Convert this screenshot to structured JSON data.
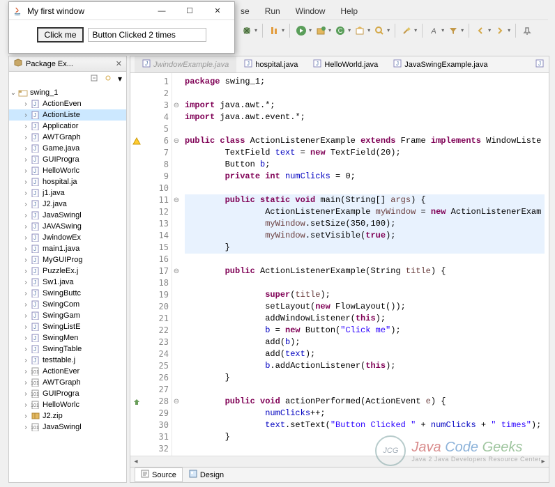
{
  "popup": {
    "title": "My first window",
    "button_label": "Click me",
    "output_text": "Button Clicked 2 times"
  },
  "menubar": {
    "items": [
      "se",
      "Run",
      "Window",
      "Help"
    ]
  },
  "package_explorer": {
    "title": "Package Ex...",
    "root": "swing_1",
    "files": [
      "ActionEven",
      "ActionListe",
      "Applicatior",
      "AWTGraph",
      "Game.java",
      "GUIProgra",
      "HelloWorlc",
      "hospital.ja",
      "j1.java",
      "J2.java",
      "JavaSwingl",
      "JAVASwing",
      "JwindowEx",
      "main1.java",
      "MyGUIProg",
      "PuzzleEx.j",
      "Sw1.java",
      "SwingButtc",
      "SwingCom",
      "SwingGam",
      "SwingListE",
      "SwingMen",
      "SwingTable",
      "testtable.j",
      "ActionEver",
      "AWTGraph",
      "GUIProgra",
      "HelloWorlc",
      "J2.zip",
      "JavaSwingl"
    ],
    "selected_index": 1
  },
  "editor_tabs": {
    "hidden": "JwindowExample.java",
    "tabs": [
      "hospital.java",
      "HelloWorld.java",
      "JavaSwingExample.java"
    ]
  },
  "code": {
    "lines": [
      {
        "n": 1,
        "t": "package swing_1;",
        "tokens": [
          [
            "kw",
            "package"
          ],
          [
            "",
            " swing_1;"
          ]
        ]
      },
      {
        "n": 2,
        "t": ""
      },
      {
        "n": 3,
        "t": "import java.awt.*;",
        "fold": "⊖",
        "tokens": [
          [
            "kw",
            "import"
          ],
          [
            "",
            " java.awt.*;"
          ]
        ]
      },
      {
        "n": 4,
        "t": "import java.awt.event.*;",
        "tokens": [
          [
            "kw",
            "import"
          ],
          [
            "",
            " java.awt.event.*;"
          ]
        ]
      },
      {
        "n": 5,
        "t": ""
      },
      {
        "n": 6,
        "t": "public class ActionListenerExample extends Frame implements WindowListe",
        "marker": "warn",
        "fold": "⊖",
        "tokens": [
          [
            "kw",
            "public class"
          ],
          [
            "",
            " "
          ],
          [
            "type",
            "ActionListenerExample"
          ],
          [
            "",
            " "
          ],
          [
            "kw",
            "extends"
          ],
          [
            "",
            " Frame "
          ],
          [
            "kw",
            "implements"
          ],
          [
            "",
            " WindowListe"
          ]
        ]
      },
      {
        "n": 7,
        "t": "        TextField text = new TextField(20);",
        "tokens": [
          [
            "",
            "        TextField "
          ],
          [
            "field",
            "text"
          ],
          [
            "",
            " = "
          ],
          [
            "kw",
            "new"
          ],
          [
            "",
            " TextField(20);"
          ]
        ]
      },
      {
        "n": 8,
        "t": "        Button b;",
        "tokens": [
          [
            "",
            "        Button "
          ],
          [
            "field",
            "b"
          ],
          [
            "",
            ";"
          ]
        ]
      },
      {
        "n": 9,
        "t": "        private int numClicks = 0;",
        "tokens": [
          [
            "",
            "        "
          ],
          [
            "kw",
            "private int"
          ],
          [
            "",
            " "
          ],
          [
            "field",
            "numClicks"
          ],
          [
            "",
            " = 0;"
          ]
        ]
      },
      {
        "n": 10,
        "t": ""
      },
      {
        "n": 11,
        "t": "        public static void main(String[] args) {",
        "fold": "⊖",
        "hl": true,
        "tokens": [
          [
            "",
            "        "
          ],
          [
            "kw",
            "public static void"
          ],
          [
            "",
            " main(String[] "
          ],
          [
            "var",
            "args"
          ],
          [
            "",
            ") {"
          ]
        ]
      },
      {
        "n": 12,
        "t": "                ActionListenerExample myWindow = new ActionListenerExam",
        "hl": true,
        "tokens": [
          [
            "",
            "                ActionListenerExample "
          ],
          [
            "var",
            "myWindow"
          ],
          [
            "",
            " = "
          ],
          [
            "kw",
            "new"
          ],
          [
            "",
            " ActionListenerExam"
          ]
        ]
      },
      {
        "n": 13,
        "t": "                myWindow.setSize(350,100);",
        "hl": true,
        "tokens": [
          [
            "",
            "                "
          ],
          [
            "var",
            "myWindow"
          ],
          [
            "",
            ".setSize(350,100);"
          ]
        ]
      },
      {
        "n": 14,
        "t": "                myWindow.setVisible(true);",
        "hl": true,
        "tokens": [
          [
            "",
            "                "
          ],
          [
            "var",
            "myWindow"
          ],
          [
            "",
            ".setVisible("
          ],
          [
            "kw",
            "true"
          ],
          [
            "",
            ");"
          ]
        ]
      },
      {
        "n": 15,
        "t": "        }",
        "hl": true
      },
      {
        "n": 16,
        "t": ""
      },
      {
        "n": 17,
        "t": "        public ActionListenerExample(String title) {",
        "fold": "⊖",
        "tokens": [
          [
            "",
            "        "
          ],
          [
            "kw",
            "public"
          ],
          [
            "",
            " ActionListenerExample(String "
          ],
          [
            "var",
            "title"
          ],
          [
            "",
            ") {"
          ]
        ]
      },
      {
        "n": 18,
        "t": ""
      },
      {
        "n": 19,
        "t": "                super(title);",
        "tokens": [
          [
            "",
            "                "
          ],
          [
            "kw",
            "super"
          ],
          [
            "",
            "("
          ],
          [
            "var",
            "title"
          ],
          [
            "",
            ");"
          ]
        ]
      },
      {
        "n": 20,
        "t": "                setLayout(new FlowLayout());",
        "tokens": [
          [
            "",
            "                setLayout("
          ],
          [
            "kw",
            "new"
          ],
          [
            "",
            " FlowLayout());"
          ]
        ]
      },
      {
        "n": 21,
        "t": "                addWindowListener(this);",
        "tokens": [
          [
            "",
            "                addWindowListener("
          ],
          [
            "kw",
            "this"
          ],
          [
            "",
            ");"
          ]
        ]
      },
      {
        "n": 22,
        "t": "                b = new Button(\"Click me\");",
        "tokens": [
          [
            "",
            "                "
          ],
          [
            "field",
            "b"
          ],
          [
            "",
            " = "
          ],
          [
            "kw",
            "new"
          ],
          [
            "",
            " Button("
          ],
          [
            "str",
            "\"Click me\""
          ],
          [
            "",
            ");"
          ]
        ]
      },
      {
        "n": 23,
        "t": "                add(b);",
        "tokens": [
          [
            "",
            "                add("
          ],
          [
            "field",
            "b"
          ],
          [
            "",
            ");"
          ]
        ]
      },
      {
        "n": 24,
        "t": "                add(text);",
        "tokens": [
          [
            "",
            "                add("
          ],
          [
            "field",
            "text"
          ],
          [
            "",
            ");"
          ]
        ]
      },
      {
        "n": 25,
        "t": "                b.addActionListener(this);",
        "tokens": [
          [
            "",
            "                "
          ],
          [
            "field",
            "b"
          ],
          [
            "",
            ".addActionListener("
          ],
          [
            "kw",
            "this"
          ],
          [
            "",
            ");"
          ]
        ]
      },
      {
        "n": 26,
        "t": "        }"
      },
      {
        "n": 27,
        "t": ""
      },
      {
        "n": 28,
        "t": "        public void actionPerformed(ActionEvent e) {",
        "fold": "⊖",
        "marker": "override",
        "tokens": [
          [
            "",
            "        "
          ],
          [
            "kw",
            "public void"
          ],
          [
            "",
            " actionPerformed(ActionEvent "
          ],
          [
            "var",
            "e"
          ],
          [
            "",
            ") {"
          ]
        ]
      },
      {
        "n": 29,
        "t": "                numClicks++;",
        "tokens": [
          [
            "",
            "                "
          ],
          [
            "field",
            "numClicks"
          ],
          [
            "",
            "++;"
          ]
        ]
      },
      {
        "n": 30,
        "t": "                text.setText(\"Button Clicked \" + numClicks + \" times\");",
        "tokens": [
          [
            "",
            "                "
          ],
          [
            "field",
            "text"
          ],
          [
            "",
            ".setText("
          ],
          [
            "str",
            "\"Button Clicked \""
          ],
          [
            "",
            " + "
          ],
          [
            "field",
            "numClicks"
          ],
          [
            "",
            " + "
          ],
          [
            "str",
            "\" times\""
          ],
          [
            "",
            ");"
          ]
        ]
      },
      {
        "n": 31,
        "t": "        }"
      },
      {
        "n": 32,
        "t": ""
      }
    ]
  },
  "bottom_tabs": {
    "source": "Source",
    "design": "Design"
  },
  "watermark": {
    "circle": "JCG",
    "line1_java": "Java",
    "line1_code": "Code",
    "line1_geeks": "Geeks",
    "sub": "Java 2 Java Developers Resource Center"
  }
}
